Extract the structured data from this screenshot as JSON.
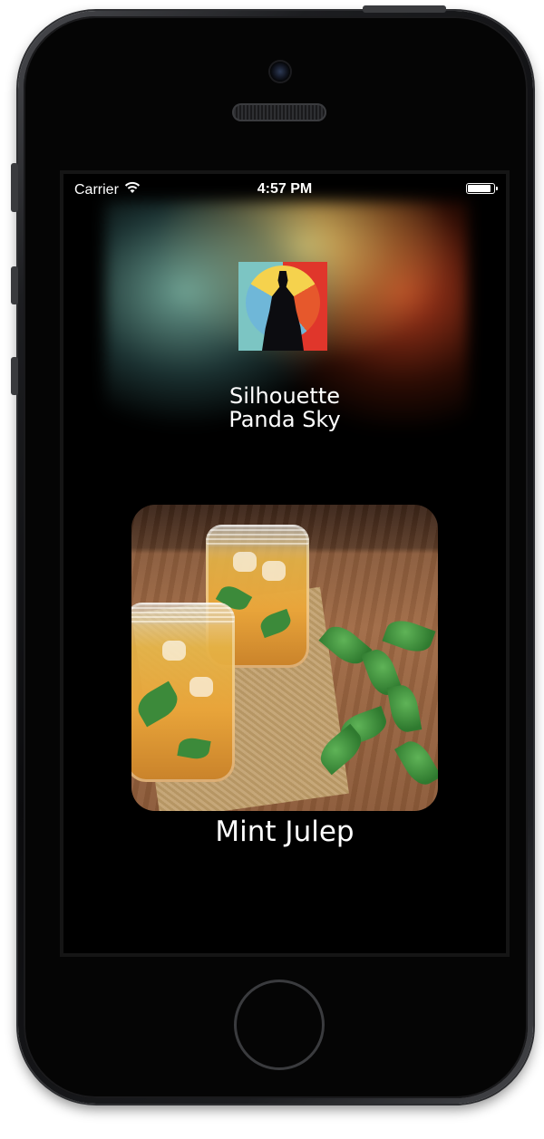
{
  "status_bar": {
    "carrier": "Carrier",
    "time": "4:57 PM"
  },
  "now_playing": {
    "title": "Silhouette\nPanda Sky"
  },
  "drink": {
    "name": "Mint Julep"
  },
  "icons": {
    "wifi": "wifi-icon",
    "battery": "battery-icon"
  },
  "colors": {
    "background": "#000000",
    "text": "#ffffff"
  },
  "battery_level": 0.9
}
